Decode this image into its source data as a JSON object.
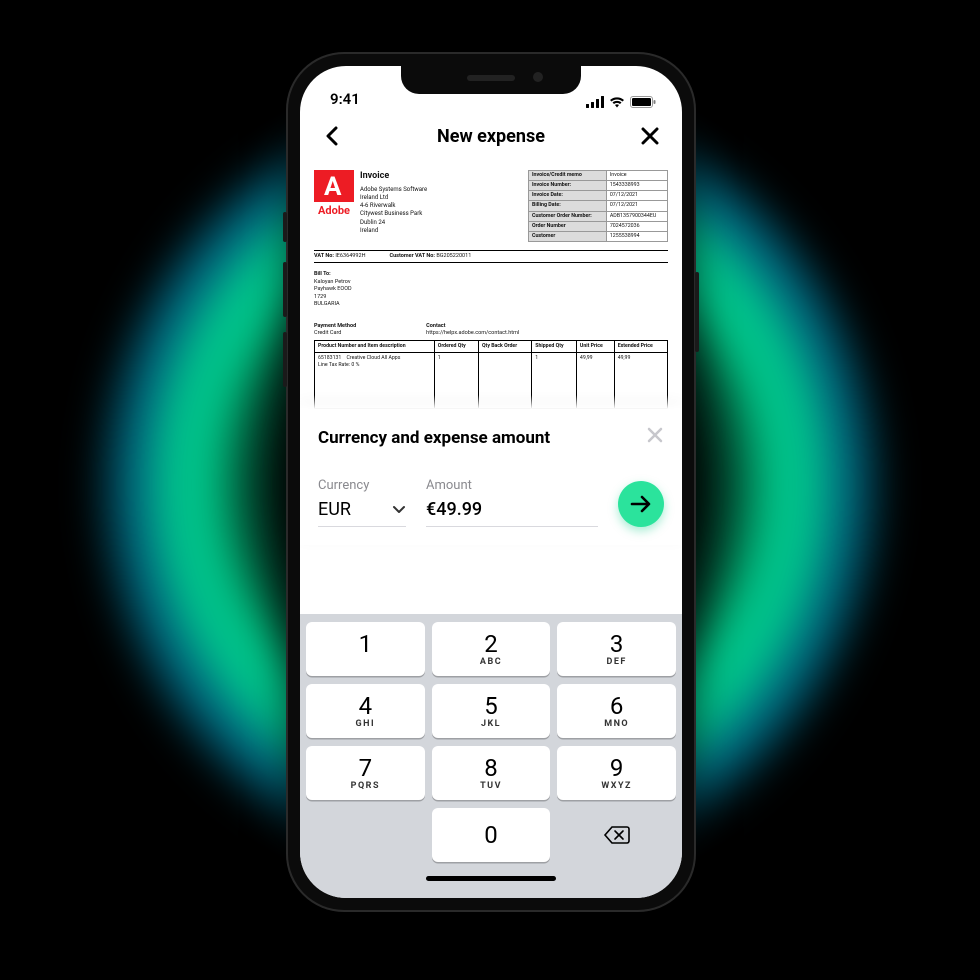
{
  "status": {
    "time": "9:41"
  },
  "nav": {
    "title": "New expense"
  },
  "invoice": {
    "title": "Invoice",
    "company": "Adobe Systems Software",
    "addr1": "Ireland Ltd",
    "addr2": "4-6 Riverwalk",
    "addr3": "Citywest Business Park",
    "addr4": "Dublin 24",
    "addr5": "Ireland",
    "logo_word": "Adobe",
    "vat_no_label": "VAT No:",
    "vat_no": "IE6364992H",
    "cust_vat_label": "Customer VAT No:",
    "cust_vat": "BG205220011",
    "meta": {
      "doc_type_label": "Invoice/Credit memo",
      "doc_type": "Invoice",
      "inv_no_label": "Invoice Number:",
      "inv_no": "1543338993",
      "inv_date_label": "Invoice Date:",
      "inv_date": "07/12/2021",
      "bill_date_label": "Billing Date:",
      "bill_date": "07/12/2021",
      "cust_order_label": "Customer Order Number:",
      "cust_order": "ADB1357900344EU",
      "order_no_label": "Order Number",
      "order_no": "7024572036",
      "customer_label": "Customer",
      "customer": "1255538994"
    },
    "bill_to_label": "Bill To:",
    "bill_to_name": "Kaloyan Petrov",
    "bill_to_co": "Payhawk EOOD",
    "bill_to_zip": "1729",
    "bill_to_country": "BULGARIA",
    "pay_method_label": "Payment Method",
    "pay_method": "Credit Card",
    "contact_label": "Contact",
    "contact": "https://helpx.adobe.com/contact.html",
    "table": {
      "h_desc": "Product Number and Item description",
      "h_qty": "Ordered Qty",
      "h_back": "Qty Back Order",
      "h_ship": "Shipped Qty",
      "h_unit": "Unit Price",
      "h_ext": "Extended Price",
      "row": {
        "sku": "65183131",
        "name": "Creative Cloud All Apps",
        "tax_label": "Line Tax Rate:",
        "tax": "0    %",
        "qty": "1",
        "back": "",
        "ship": "1",
        "unit": "49,99",
        "ext": "49,99"
      }
    }
  },
  "sheet": {
    "title": "Currency and expense amount",
    "currency_label": "Currency",
    "currency_value": "EUR",
    "amount_label": "Amount",
    "amount_value": "€49.99"
  },
  "keys": {
    "k1": "1",
    "k2": "2",
    "k2s": "ABC",
    "k3": "3",
    "k3s": "DEF",
    "k4": "4",
    "k4s": "GHI",
    "k5": "5",
    "k5s": "JKL",
    "k6": "6",
    "k6s": "MNO",
    "k7": "7",
    "k7s": "PQRS",
    "k8": "8",
    "k8s": "TUV",
    "k9": "9",
    "k9s": "WXYZ",
    "k0": "0"
  }
}
